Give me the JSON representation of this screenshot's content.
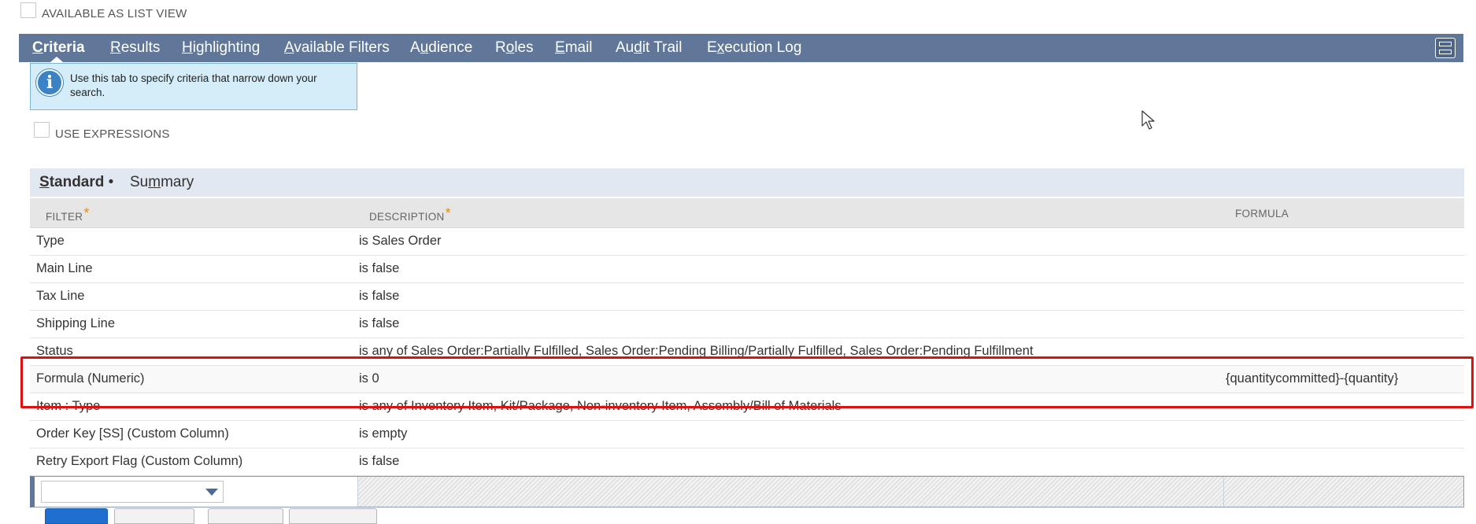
{
  "top_checkbox": {
    "label": "AVAILABLE AS LIST VIEW",
    "checked": false
  },
  "main_tabs": [
    {
      "label_parts": [
        "",
        "C",
        "riteria"
      ],
      "active": true
    },
    {
      "label_parts": [
        "",
        "R",
        "esults"
      ],
      "active": false
    },
    {
      "label_parts": [
        "",
        "H",
        "ighlighting"
      ],
      "active": false
    },
    {
      "label_parts": [
        "",
        "A",
        "vailable Filters"
      ],
      "active": false
    },
    {
      "label_parts": [
        "A",
        "u",
        "dience"
      ],
      "active": false
    },
    {
      "label_parts": [
        "R",
        "o",
        "les"
      ],
      "active": false
    },
    {
      "label_parts": [
        "",
        "E",
        "mail"
      ],
      "active": false
    },
    {
      "label_parts": [
        "Au",
        "d",
        "it Trail"
      ],
      "active": false
    },
    {
      "label_parts": [
        "E",
        "x",
        "ecution Log"
      ],
      "active": false
    }
  ],
  "tooltip": {
    "text": "Use this tab to specify criteria that narrow down your search.",
    "icon": "info-icon"
  },
  "use_expressions": {
    "label": "USE EXPRESSIONS",
    "checked": false
  },
  "sub_tabs": [
    {
      "label_parts": [
        "",
        "S",
        "tandard"
      ],
      "suffix": " •",
      "active": true
    },
    {
      "label_parts": [
        "Su",
        "m",
        "mary"
      ],
      "suffix": "",
      "active": false
    }
  ],
  "table": {
    "headers": {
      "filter": "FILTER",
      "description": "DESCRIPTION",
      "formula": "FORMULA",
      "required_mark": "*"
    },
    "rows": [
      {
        "filter": "Type",
        "description": "is Sales Order",
        "formula": ""
      },
      {
        "filter": "Main Line",
        "description": "is false",
        "formula": ""
      },
      {
        "filter": "Tax Line",
        "description": "is false",
        "formula": ""
      },
      {
        "filter": "Shipping Line",
        "description": "is false",
        "formula": ""
      },
      {
        "filter": "Status",
        "description": "is any of Sales Order:Partially Fulfilled, Sales Order:Pending Billing/Partially Fulfilled, Sales Order:Pending Fulfillment",
        "formula": ""
      },
      {
        "filter": "Formula (Numeric)",
        "description": "is 0",
        "formula": "{quantitycommitted}-{quantity}"
      },
      {
        "filter": "Item : Type",
        "description": "is any of Inventory Item, Kit/Package, Non-inventory Item, Assembly/Bill of Materials",
        "formula": ""
      },
      {
        "filter": "Order Key [SS] (Custom Column)",
        "description": "is empty",
        "formula": ""
      },
      {
        "filter": "Retry Export Flag (Custom Column)",
        "description": "is false",
        "formula": ""
      }
    ]
  },
  "edit_row": {
    "select_value": ""
  },
  "colors": {
    "tab_bar": "#607799",
    "highlight": "#e01010",
    "tooltip_bg": "#d5edf9",
    "required": "#e08f1c"
  }
}
